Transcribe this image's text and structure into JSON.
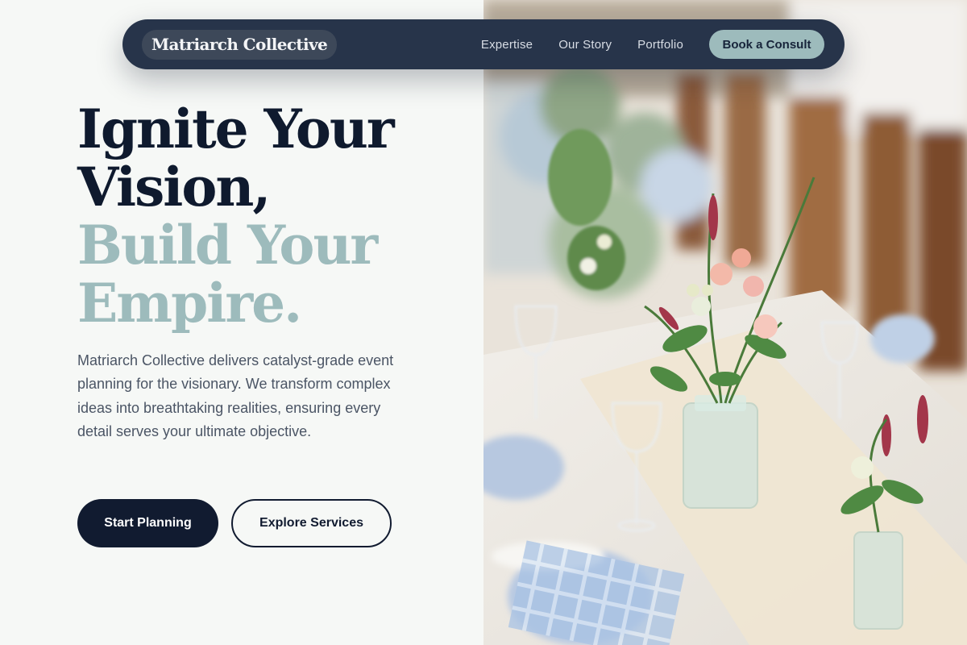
{
  "nav": {
    "brand": "Matriarch Collective",
    "links": [
      "Expertise",
      "Our Story",
      "Portfolio"
    ],
    "cta": "Book a Consult"
  },
  "hero": {
    "headline_line1": "Ignite Your",
    "headline_line2": "Vision,",
    "headline_accent_line1": "Build Your",
    "headline_accent_line2": "Empire.",
    "lead": "Matriarch Collective delivers catalyst-grade event planning for the visionary. We transform complex ideas into breathtaking realities, ensuring every detail serves your ultimate objective.",
    "primary_button": "Start Planning",
    "secondary_button": "Explore Services"
  },
  "colors": {
    "navy": "#111b30",
    "nav_bg": "#27344a",
    "accent_sage": "#9dbbbc",
    "page_bg": "#f6f8f6"
  },
  "icons": {}
}
